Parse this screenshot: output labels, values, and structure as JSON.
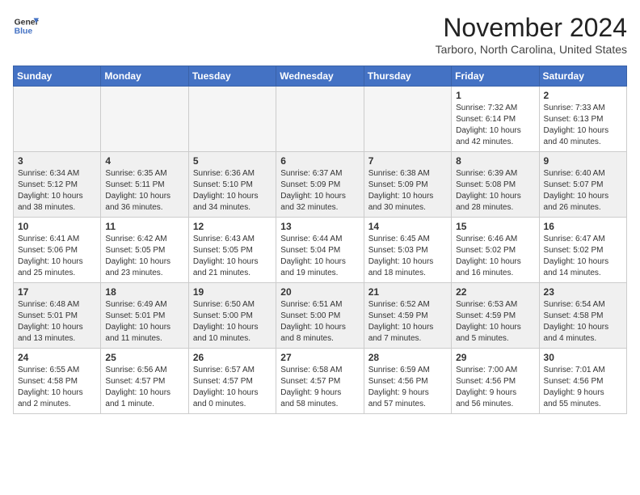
{
  "header": {
    "logo_line1": "General",
    "logo_line2": "Blue",
    "month": "November 2024",
    "location": "Tarboro, North Carolina, United States"
  },
  "weekdays": [
    "Sunday",
    "Monday",
    "Tuesday",
    "Wednesday",
    "Thursday",
    "Friday",
    "Saturday"
  ],
  "weeks": [
    [
      {
        "day": "",
        "info": ""
      },
      {
        "day": "",
        "info": ""
      },
      {
        "day": "",
        "info": ""
      },
      {
        "day": "",
        "info": ""
      },
      {
        "day": "",
        "info": ""
      },
      {
        "day": "1",
        "info": "Sunrise: 7:32 AM\nSunset: 6:14 PM\nDaylight: 10 hours\nand 42 minutes."
      },
      {
        "day": "2",
        "info": "Sunrise: 7:33 AM\nSunset: 6:13 PM\nDaylight: 10 hours\nand 40 minutes."
      }
    ],
    [
      {
        "day": "3",
        "info": "Sunrise: 6:34 AM\nSunset: 5:12 PM\nDaylight: 10 hours\nand 38 minutes."
      },
      {
        "day": "4",
        "info": "Sunrise: 6:35 AM\nSunset: 5:11 PM\nDaylight: 10 hours\nand 36 minutes."
      },
      {
        "day": "5",
        "info": "Sunrise: 6:36 AM\nSunset: 5:10 PM\nDaylight: 10 hours\nand 34 minutes."
      },
      {
        "day": "6",
        "info": "Sunrise: 6:37 AM\nSunset: 5:09 PM\nDaylight: 10 hours\nand 32 minutes."
      },
      {
        "day": "7",
        "info": "Sunrise: 6:38 AM\nSunset: 5:09 PM\nDaylight: 10 hours\nand 30 minutes."
      },
      {
        "day": "8",
        "info": "Sunrise: 6:39 AM\nSunset: 5:08 PM\nDaylight: 10 hours\nand 28 minutes."
      },
      {
        "day": "9",
        "info": "Sunrise: 6:40 AM\nSunset: 5:07 PM\nDaylight: 10 hours\nand 26 minutes."
      }
    ],
    [
      {
        "day": "10",
        "info": "Sunrise: 6:41 AM\nSunset: 5:06 PM\nDaylight: 10 hours\nand 25 minutes."
      },
      {
        "day": "11",
        "info": "Sunrise: 6:42 AM\nSunset: 5:05 PM\nDaylight: 10 hours\nand 23 minutes."
      },
      {
        "day": "12",
        "info": "Sunrise: 6:43 AM\nSunset: 5:05 PM\nDaylight: 10 hours\nand 21 minutes."
      },
      {
        "day": "13",
        "info": "Sunrise: 6:44 AM\nSunset: 5:04 PM\nDaylight: 10 hours\nand 19 minutes."
      },
      {
        "day": "14",
        "info": "Sunrise: 6:45 AM\nSunset: 5:03 PM\nDaylight: 10 hours\nand 18 minutes."
      },
      {
        "day": "15",
        "info": "Sunrise: 6:46 AM\nSunset: 5:02 PM\nDaylight: 10 hours\nand 16 minutes."
      },
      {
        "day": "16",
        "info": "Sunrise: 6:47 AM\nSunset: 5:02 PM\nDaylight: 10 hours\nand 14 minutes."
      }
    ],
    [
      {
        "day": "17",
        "info": "Sunrise: 6:48 AM\nSunset: 5:01 PM\nDaylight: 10 hours\nand 13 minutes."
      },
      {
        "day": "18",
        "info": "Sunrise: 6:49 AM\nSunset: 5:01 PM\nDaylight: 10 hours\nand 11 minutes."
      },
      {
        "day": "19",
        "info": "Sunrise: 6:50 AM\nSunset: 5:00 PM\nDaylight: 10 hours\nand 10 minutes."
      },
      {
        "day": "20",
        "info": "Sunrise: 6:51 AM\nSunset: 5:00 PM\nDaylight: 10 hours\nand 8 minutes."
      },
      {
        "day": "21",
        "info": "Sunrise: 6:52 AM\nSunset: 4:59 PM\nDaylight: 10 hours\nand 7 minutes."
      },
      {
        "day": "22",
        "info": "Sunrise: 6:53 AM\nSunset: 4:59 PM\nDaylight: 10 hours\nand 5 minutes."
      },
      {
        "day": "23",
        "info": "Sunrise: 6:54 AM\nSunset: 4:58 PM\nDaylight: 10 hours\nand 4 minutes."
      }
    ],
    [
      {
        "day": "24",
        "info": "Sunrise: 6:55 AM\nSunset: 4:58 PM\nDaylight: 10 hours\nand 2 minutes."
      },
      {
        "day": "25",
        "info": "Sunrise: 6:56 AM\nSunset: 4:57 PM\nDaylight: 10 hours\nand 1 minute."
      },
      {
        "day": "26",
        "info": "Sunrise: 6:57 AM\nSunset: 4:57 PM\nDaylight: 10 hours\nand 0 minutes."
      },
      {
        "day": "27",
        "info": "Sunrise: 6:58 AM\nSunset: 4:57 PM\nDaylight: 9 hours\nand 58 minutes."
      },
      {
        "day": "28",
        "info": "Sunrise: 6:59 AM\nSunset: 4:56 PM\nDaylight: 9 hours\nand 57 minutes."
      },
      {
        "day": "29",
        "info": "Sunrise: 7:00 AM\nSunset: 4:56 PM\nDaylight: 9 hours\nand 56 minutes."
      },
      {
        "day": "30",
        "info": "Sunrise: 7:01 AM\nSunset: 4:56 PM\nDaylight: 9 hours\nand 55 minutes."
      }
    ]
  ]
}
